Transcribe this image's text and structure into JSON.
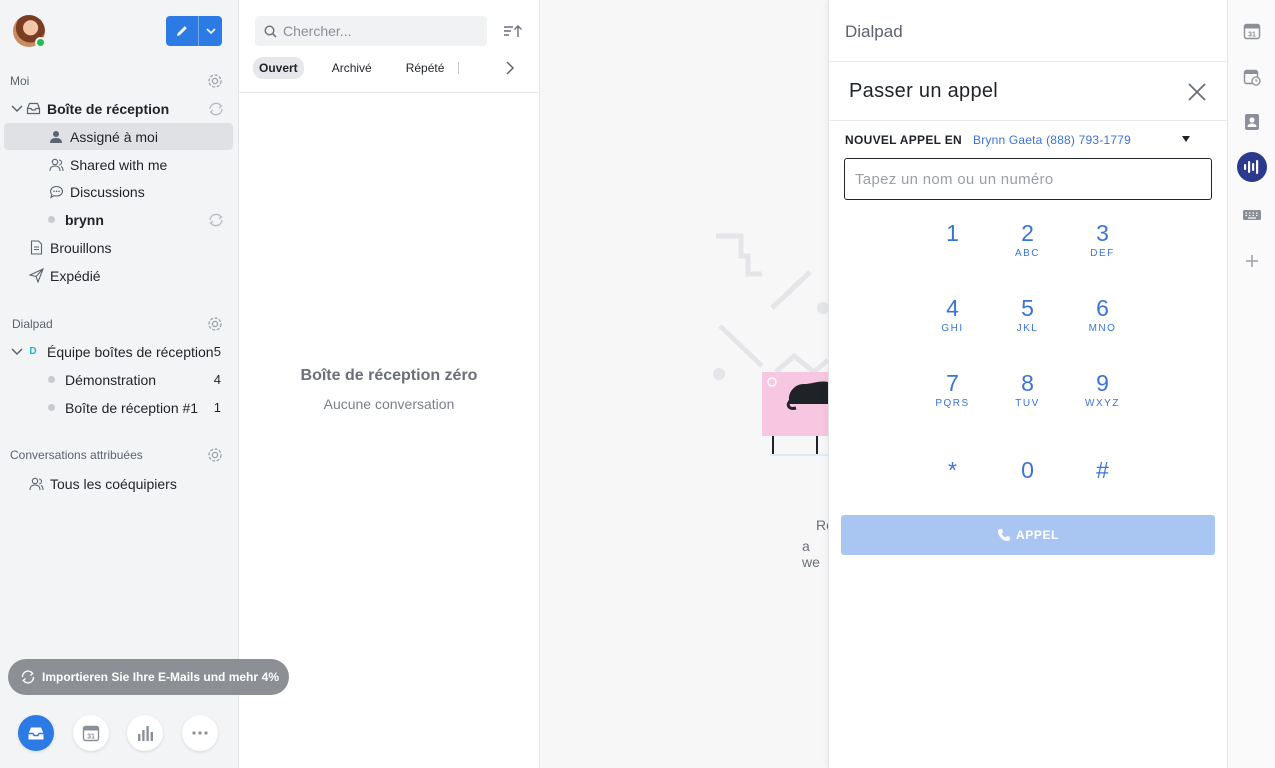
{
  "sidebar": {
    "sections": {
      "me": "Moi",
      "dialpad": "Dialpad",
      "assigned": "Conversations attribuées"
    },
    "items": [
      {
        "label": "Boîte de réception"
      },
      {
        "label": "Assigné à moi"
      },
      {
        "label": "Shared with me"
      },
      {
        "label": "Discussions"
      },
      {
        "label": "brynn"
      },
      {
        "label": "Brouillons"
      },
      {
        "label": "Expédié"
      }
    ],
    "team": {
      "badge": "D",
      "label": "Équipe boîtes de réception",
      "count": "5",
      "children": [
        {
          "label": "Démonstration",
          "count": "4"
        },
        {
          "label": "Boîte de réception #1",
          "count": "1"
        }
      ]
    },
    "teammates": "Tous les coéquipiers",
    "import": {
      "label": "Importieren Sie Ihre E-Mails und mehr",
      "progress": "4%"
    }
  },
  "conversations": {
    "search_placeholder": "Chercher...",
    "tabs": [
      "Ouvert",
      "Archivé",
      "Répété"
    ],
    "empty_title": "Boîte de réception zéro",
    "empty_subtitle": "Aucune conversation"
  },
  "main": {
    "partial_line_1": "Re",
    "partial_line_2": "a we"
  },
  "dialpad": {
    "header": "Dialpad",
    "title": "Passer un appel",
    "call_from_label": "NOUVEL APPEL EN",
    "call_from_value": "Brynn Gaeta (888) 793-1779",
    "input_placeholder": "Tapez un nom ou un numéro",
    "keys": [
      {
        "num": "1",
        "sub": ""
      },
      {
        "num": "2",
        "sub": "ABC"
      },
      {
        "num": "3",
        "sub": "DEF"
      },
      {
        "num": "4",
        "sub": "GHI"
      },
      {
        "num": "5",
        "sub": "JKL"
      },
      {
        "num": "6",
        "sub": "MNO"
      },
      {
        "num": "7",
        "sub": "PQRS"
      },
      {
        "num": "8",
        "sub": "TUV"
      },
      {
        "num": "9",
        "sub": "WXYZ"
      },
      {
        "num": "*",
        "sub": ""
      },
      {
        "num": "0",
        "sub": ""
      },
      {
        "num": "#",
        "sub": ""
      }
    ],
    "call_button": "APPEL"
  },
  "rail": {
    "calendar_day": "31"
  },
  "colors": {
    "accent": "#2c7be5",
    "link": "#3a74d6",
    "call_disabled": "#a9c6f3",
    "dialpad_brand": "#2b3a8c",
    "presence": "#1fbf4f"
  },
  "icons": [
    "compose-icon",
    "chevron-down-icon",
    "gear-icon",
    "inbox-icon",
    "assigned-icon",
    "shared-icon",
    "chat-icon",
    "sync-icon",
    "draft-icon",
    "send-icon",
    "team-icon",
    "search-icon",
    "sort-icon",
    "chevron-right-icon",
    "close-icon",
    "caret-down-icon",
    "phone-icon",
    "calendar-icon",
    "calendar-clock-icon",
    "contact-card-icon",
    "dialpad-icon",
    "keyboard-icon",
    "plus-icon",
    "analytics-icon",
    "more-icon"
  ]
}
